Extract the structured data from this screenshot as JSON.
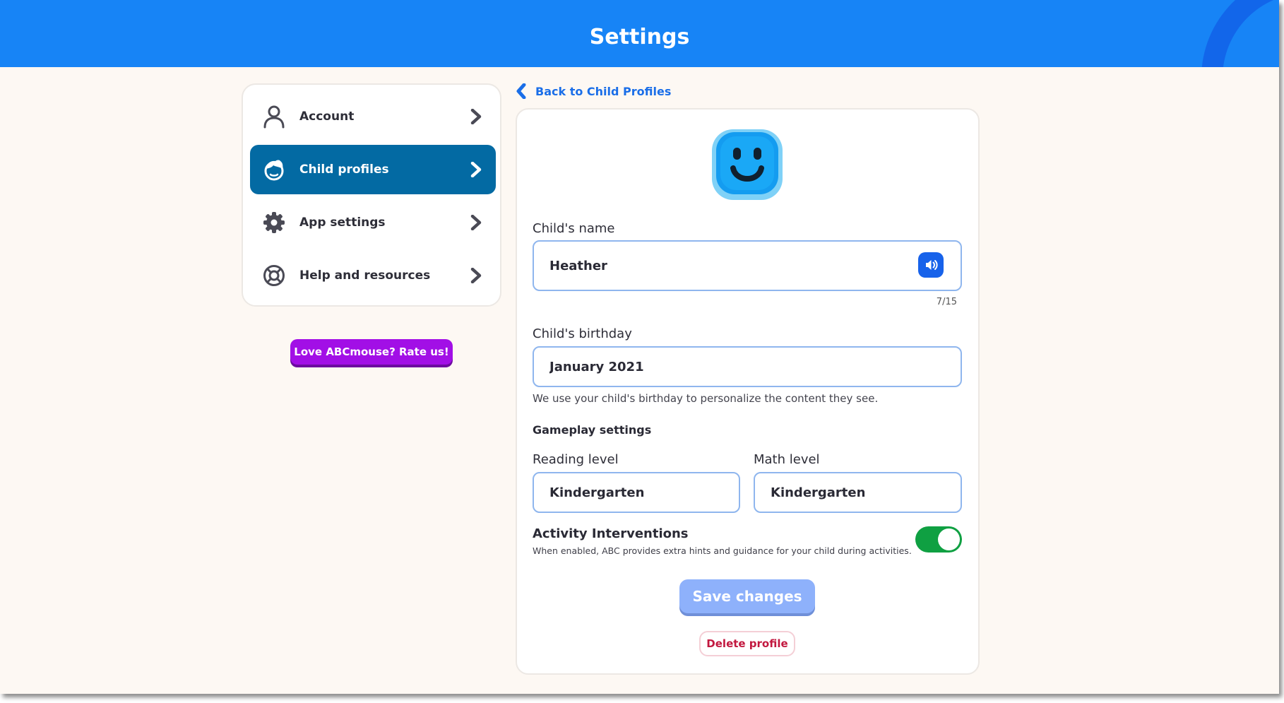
{
  "header": {
    "title": "Settings"
  },
  "sidebar": {
    "items": [
      {
        "label": "Account",
        "icon": "user-icon",
        "active": false
      },
      {
        "label": "Child profiles",
        "icon": "child-face-icon",
        "active": true
      },
      {
        "label": "App settings",
        "icon": "gear-icon",
        "active": false
      },
      {
        "label": "Help and resources",
        "icon": "lifebuoy-icon",
        "active": false
      }
    ]
  },
  "rate_button": {
    "label": "Love ABCmouse? Rate us!"
  },
  "back_link": {
    "label": "Back to Child Profiles"
  },
  "form": {
    "name_label": "Child's name",
    "name_value": "Heather",
    "name_count": "7/15",
    "birthday_label": "Child's birthday",
    "birthday_value": "January 2021",
    "birthday_help": "We use your child's birthday to personalize the content they see.",
    "gameplay_heading": "Gameplay settings",
    "reading_label": "Reading level",
    "reading_value": "Kindergarten",
    "math_label": "Math level",
    "math_value": "Kindergarten",
    "interventions_title": "Activity Interventions",
    "interventions_desc": "When enabled, ABC provides extra hints and guidance for your child during activities.",
    "interventions_enabled": true,
    "save_label": "Save changes",
    "delete_label": "Delete profile"
  },
  "colors": {
    "header": "#1784f6",
    "active_nav": "#036aa3",
    "rate_button": "#a20fe6",
    "toggle_on": "#0fa042",
    "save_button": "#8eb1fb",
    "delete_text": "#c2183f",
    "link": "#1a6ee8"
  }
}
